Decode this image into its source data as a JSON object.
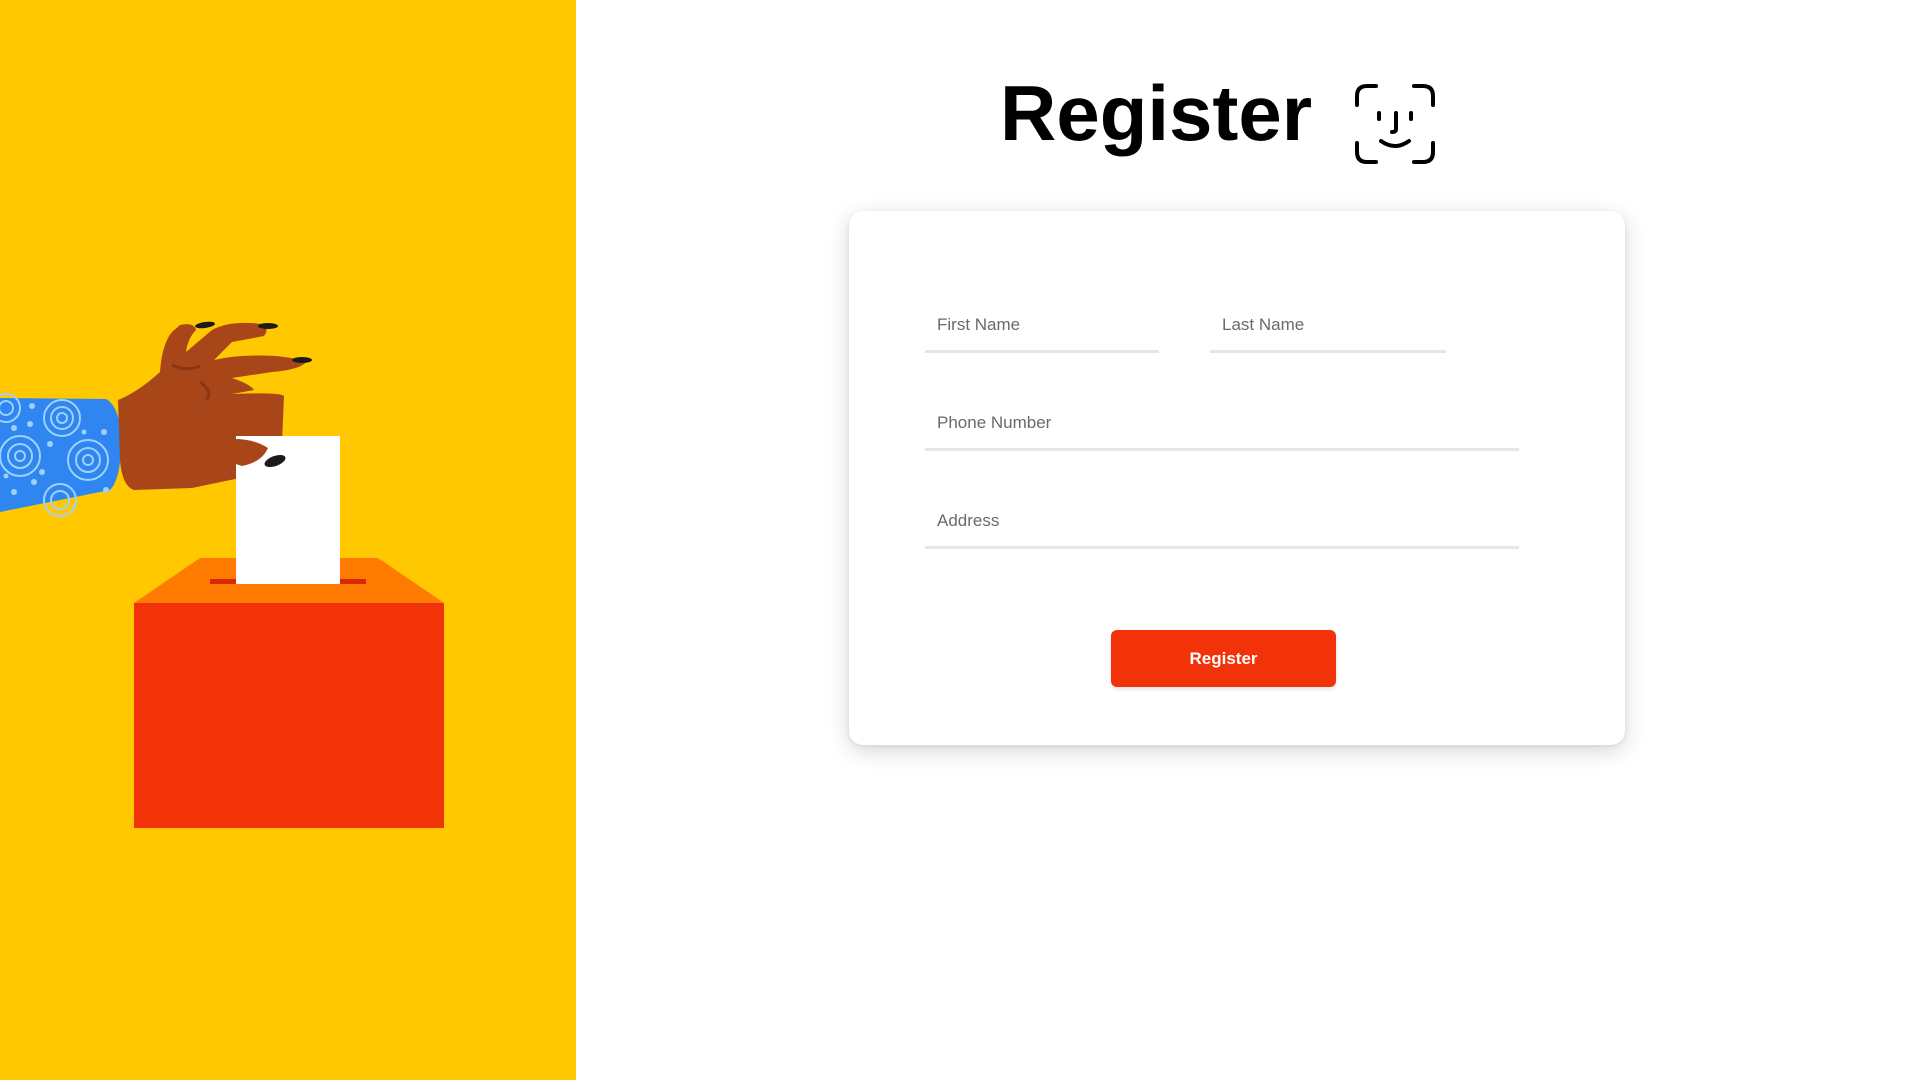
{
  "header": {
    "title": "Register",
    "icon": "face-id-icon"
  },
  "form": {
    "first_name": {
      "placeholder": "First Name",
      "value": ""
    },
    "last_name": {
      "placeholder": "Last Name",
      "value": ""
    },
    "phone": {
      "placeholder": "Phone Number",
      "value": ""
    },
    "address": {
      "placeholder": "Address",
      "value": ""
    },
    "submit_label": "Register"
  },
  "illustration": {
    "subject": "hand-casting-ballot-icon",
    "colors": {
      "background": "#FFC800",
      "box_front": "#F2330A",
      "box_top": "#FF7A00",
      "ballot": "#FFFFFF",
      "skin": "#A8461A",
      "sleeve": "#2F86F0"
    }
  },
  "colors": {
    "accent": "#F2330A",
    "left_panel": "#FFC800",
    "underline": "#E6E6E6"
  }
}
